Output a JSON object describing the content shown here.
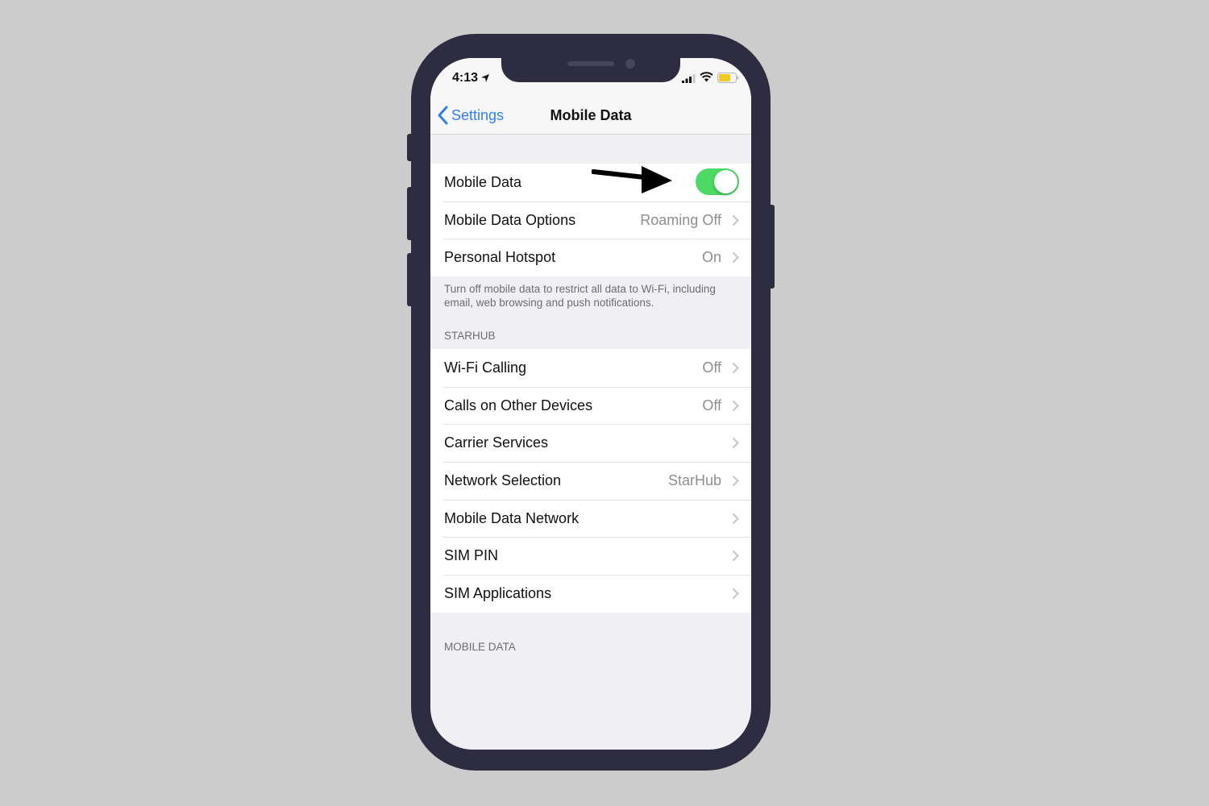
{
  "status_bar": {
    "time": "4:13",
    "icons": [
      "location-arrow-icon",
      "cellular-signal-icon",
      "wifi-icon",
      "battery-icon"
    ],
    "battery_color": "#f5c824"
  },
  "nav": {
    "back_label": "Settings",
    "title": "Mobile Data"
  },
  "groups": {
    "main": {
      "rows": [
        {
          "label": "Mobile Data",
          "control": "toggle",
          "toggle_on": true
        },
        {
          "label": "Mobile Data Options",
          "value": "Roaming Off"
        },
        {
          "label": "Personal Hotspot",
          "value": "On"
        }
      ],
      "footer": "Turn off mobile data to restrict all data to Wi-Fi, including email, web browsing and push notifications."
    },
    "starhub": {
      "header": "STARHUB",
      "rows": [
        {
          "label": "Wi-Fi Calling",
          "value": "Off"
        },
        {
          "label": "Calls on Other Devices",
          "value": "Off"
        },
        {
          "label": "Carrier Services",
          "value": ""
        },
        {
          "label": "Network Selection",
          "value": "StarHub"
        },
        {
          "label": "Mobile Data Network",
          "value": ""
        },
        {
          "label": "SIM PIN",
          "value": ""
        },
        {
          "label": "SIM Applications",
          "value": ""
        }
      ]
    },
    "mobile_data": {
      "header": "MOBILE DATA"
    }
  },
  "colors": {
    "accent": "#2f7ff5",
    "toggle_on": "#4cd964",
    "phone_frame": "#2d2c40",
    "background": "#cccccc"
  }
}
